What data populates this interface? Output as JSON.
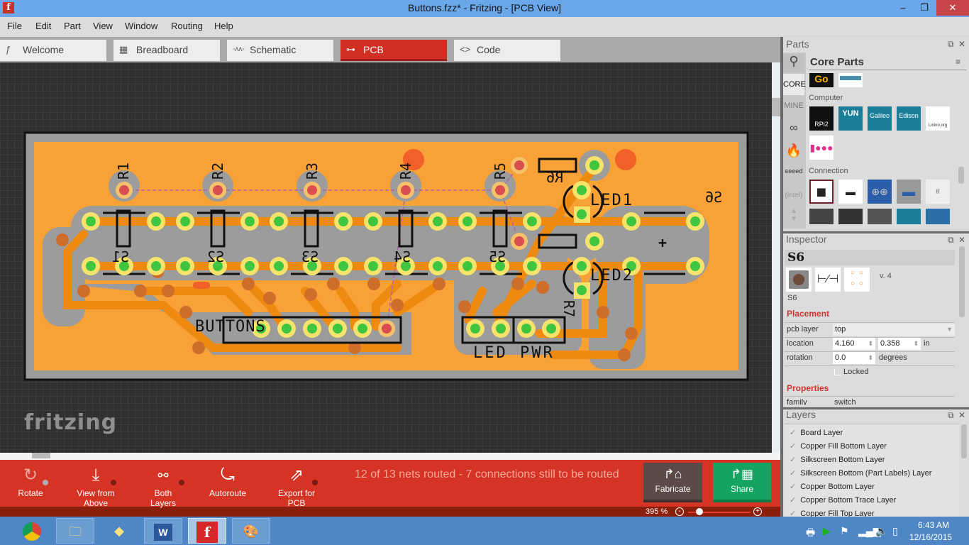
{
  "window": {
    "title": "Buttons.fzz* - Fritzing - [PCB View]",
    "app_icon": "fritzing-f-icon",
    "minimize": "–",
    "restore": "❐",
    "close": "✕"
  },
  "menu": [
    "File",
    "Edit",
    "Part",
    "View",
    "Window",
    "Routing",
    "Help"
  ],
  "tabs": [
    {
      "label": "Welcome",
      "icon": "ƒ",
      "active": false
    },
    {
      "label": "Breadboard",
      "icon": "▦",
      "active": false
    },
    {
      "label": "Schematic",
      "icon": "-ʌʌ-",
      "active": false
    },
    {
      "label": "PCB",
      "icon": "⊶",
      "active": true
    },
    {
      "label": "Code",
      "icon": "<>",
      "active": false
    }
  ],
  "canvas": {
    "logo": "fritzing",
    "board": {
      "resistor_labels": [
        "R1",
        "R2",
        "R3",
        "R4",
        "R5"
      ],
      "switch_labels": [
        "S1",
        "S2",
        "S3",
        "S4",
        "S5"
      ],
      "other_labels": {
        "r6": "R6",
        "r7": "R7",
        "led1": "LED1",
        "led2": "LED2",
        "s6": "S6",
        "plus": "+",
        "buttons": "BUTTONS",
        "led": "LED",
        "pwr": "PWR"
      }
    }
  },
  "toolbar": {
    "rotate": "Rotate",
    "view_from_above": "View from Above",
    "both_layers": "Both Layers",
    "autoroute": "Autoroute",
    "export_for_pcb": "Export for PCB",
    "routing_status": "12 of 13 nets routed - 7 connections still to be routed",
    "fabricate": "Fabricate",
    "share": "Share"
  },
  "zoom": {
    "level": "395 %",
    "out": "-",
    "in": "+"
  },
  "parts": {
    "title": "Parts",
    "bin_title": "Core Parts",
    "bins": [
      "CORE",
      "MINE"
    ],
    "categories": [
      {
        "name": "Computer",
        "items": [
          "RPi2",
          "YUN",
          "Galileo",
          "Edison",
          "Linino.org"
        ]
      },
      {
        "name": "Connection",
        "items": []
      }
    ],
    "top_items": [
      "Go",
      ""
    ]
  },
  "inspector": {
    "title": "Inspector",
    "part_title": "S6",
    "part_caption": "S6",
    "version": "v. 4",
    "placement_header": "Placement",
    "pcb_layer_label": "pcb layer",
    "pcb_layer_value": "top",
    "location_label": "location",
    "location_x": "4.160",
    "location_y": "0.358",
    "location_unit": "in",
    "rotation_label": "rotation",
    "rotation_value": "0.0",
    "rotation_unit": "degrees",
    "locked_label": "Locked",
    "properties_header": "Properties",
    "family_label": "family",
    "family_value": "switch"
  },
  "layers": {
    "title": "Layers",
    "items": [
      "Board Layer",
      "Copper Fill Bottom Layer",
      "Silkscreen Bottom Layer",
      "Silkscreen Bottom (Part Labels) Layer",
      "Copper Bottom Layer",
      "Copper Bottom Trace Layer",
      "Copper Fill Top Layer"
    ]
  },
  "taskbar": {
    "apps": [
      "chrome",
      "file-explorer",
      "sticky-notes",
      "word",
      "fritzing",
      "paint"
    ],
    "time": "6:43 AM",
    "date": "12/16/2015"
  }
}
